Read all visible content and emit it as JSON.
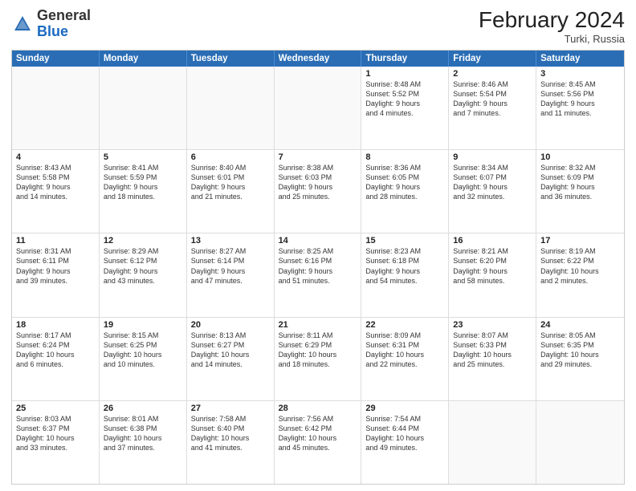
{
  "header": {
    "logo_general": "General",
    "logo_blue": "Blue",
    "month_year": "February 2024",
    "location": "Turki, Russia"
  },
  "calendar": {
    "days": [
      "Sunday",
      "Monday",
      "Tuesday",
      "Wednesday",
      "Thursday",
      "Friday",
      "Saturday"
    ],
    "rows": [
      [
        {
          "day": "",
          "info": ""
        },
        {
          "day": "",
          "info": ""
        },
        {
          "day": "",
          "info": ""
        },
        {
          "day": "",
          "info": ""
        },
        {
          "day": "1",
          "info": "Sunrise: 8:48 AM\nSunset: 5:52 PM\nDaylight: 9 hours\nand 4 minutes."
        },
        {
          "day": "2",
          "info": "Sunrise: 8:46 AM\nSunset: 5:54 PM\nDaylight: 9 hours\nand 7 minutes."
        },
        {
          "day": "3",
          "info": "Sunrise: 8:45 AM\nSunset: 5:56 PM\nDaylight: 9 hours\nand 11 minutes."
        }
      ],
      [
        {
          "day": "4",
          "info": "Sunrise: 8:43 AM\nSunset: 5:58 PM\nDaylight: 9 hours\nand 14 minutes."
        },
        {
          "day": "5",
          "info": "Sunrise: 8:41 AM\nSunset: 5:59 PM\nDaylight: 9 hours\nand 18 minutes."
        },
        {
          "day": "6",
          "info": "Sunrise: 8:40 AM\nSunset: 6:01 PM\nDaylight: 9 hours\nand 21 minutes."
        },
        {
          "day": "7",
          "info": "Sunrise: 8:38 AM\nSunset: 6:03 PM\nDaylight: 9 hours\nand 25 minutes."
        },
        {
          "day": "8",
          "info": "Sunrise: 8:36 AM\nSunset: 6:05 PM\nDaylight: 9 hours\nand 28 minutes."
        },
        {
          "day": "9",
          "info": "Sunrise: 8:34 AM\nSunset: 6:07 PM\nDaylight: 9 hours\nand 32 minutes."
        },
        {
          "day": "10",
          "info": "Sunrise: 8:32 AM\nSunset: 6:09 PM\nDaylight: 9 hours\nand 36 minutes."
        }
      ],
      [
        {
          "day": "11",
          "info": "Sunrise: 8:31 AM\nSunset: 6:11 PM\nDaylight: 9 hours\nand 39 minutes."
        },
        {
          "day": "12",
          "info": "Sunrise: 8:29 AM\nSunset: 6:12 PM\nDaylight: 9 hours\nand 43 minutes."
        },
        {
          "day": "13",
          "info": "Sunrise: 8:27 AM\nSunset: 6:14 PM\nDaylight: 9 hours\nand 47 minutes."
        },
        {
          "day": "14",
          "info": "Sunrise: 8:25 AM\nSunset: 6:16 PM\nDaylight: 9 hours\nand 51 minutes."
        },
        {
          "day": "15",
          "info": "Sunrise: 8:23 AM\nSunset: 6:18 PM\nDaylight: 9 hours\nand 54 minutes."
        },
        {
          "day": "16",
          "info": "Sunrise: 8:21 AM\nSunset: 6:20 PM\nDaylight: 9 hours\nand 58 minutes."
        },
        {
          "day": "17",
          "info": "Sunrise: 8:19 AM\nSunset: 6:22 PM\nDaylight: 10 hours\nand 2 minutes."
        }
      ],
      [
        {
          "day": "18",
          "info": "Sunrise: 8:17 AM\nSunset: 6:24 PM\nDaylight: 10 hours\nand 6 minutes."
        },
        {
          "day": "19",
          "info": "Sunrise: 8:15 AM\nSunset: 6:25 PM\nDaylight: 10 hours\nand 10 minutes."
        },
        {
          "day": "20",
          "info": "Sunrise: 8:13 AM\nSunset: 6:27 PM\nDaylight: 10 hours\nand 14 minutes."
        },
        {
          "day": "21",
          "info": "Sunrise: 8:11 AM\nSunset: 6:29 PM\nDaylight: 10 hours\nand 18 minutes."
        },
        {
          "day": "22",
          "info": "Sunrise: 8:09 AM\nSunset: 6:31 PM\nDaylight: 10 hours\nand 22 minutes."
        },
        {
          "day": "23",
          "info": "Sunrise: 8:07 AM\nSunset: 6:33 PM\nDaylight: 10 hours\nand 25 minutes."
        },
        {
          "day": "24",
          "info": "Sunrise: 8:05 AM\nSunset: 6:35 PM\nDaylight: 10 hours\nand 29 minutes."
        }
      ],
      [
        {
          "day": "25",
          "info": "Sunrise: 8:03 AM\nSunset: 6:37 PM\nDaylight: 10 hours\nand 33 minutes."
        },
        {
          "day": "26",
          "info": "Sunrise: 8:01 AM\nSunset: 6:38 PM\nDaylight: 10 hours\nand 37 minutes."
        },
        {
          "day": "27",
          "info": "Sunrise: 7:58 AM\nSunset: 6:40 PM\nDaylight: 10 hours\nand 41 minutes."
        },
        {
          "day": "28",
          "info": "Sunrise: 7:56 AM\nSunset: 6:42 PM\nDaylight: 10 hours\nand 45 minutes."
        },
        {
          "day": "29",
          "info": "Sunrise: 7:54 AM\nSunset: 6:44 PM\nDaylight: 10 hours\nand 49 minutes."
        },
        {
          "day": "",
          "info": ""
        },
        {
          "day": "",
          "info": ""
        }
      ]
    ]
  }
}
